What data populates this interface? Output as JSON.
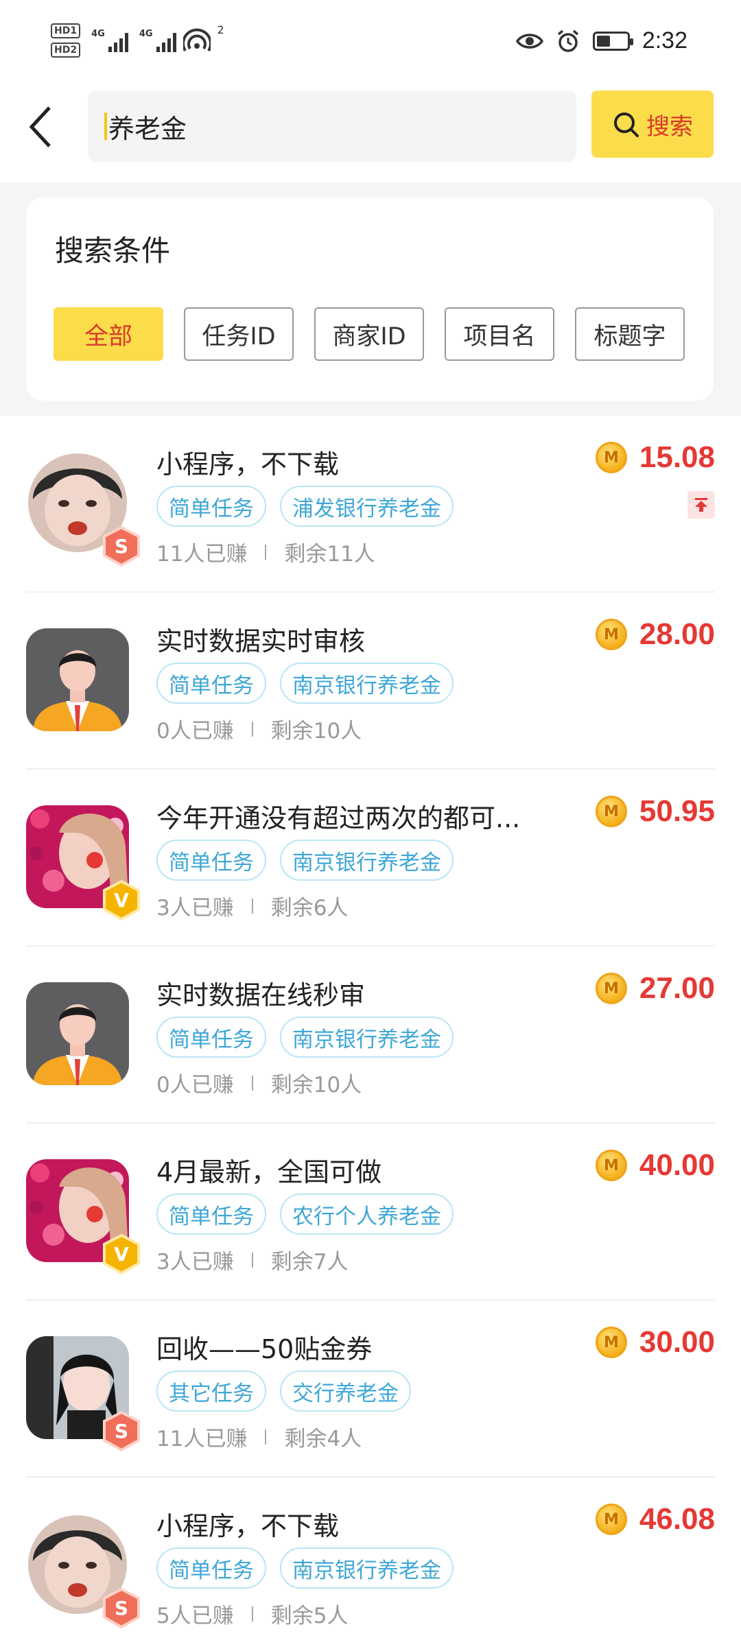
{
  "status_bar": {
    "time": "2:32",
    "hd1": "HD1",
    "hd2": "HD2",
    "net1": "4G",
    "net2": "4G",
    "wifi_sup": "2",
    "battery_level": 0.45
  },
  "header": {
    "search_value": "养老金",
    "search_button": "搜索"
  },
  "conditions": {
    "title": "搜索条件",
    "chips": [
      {
        "label": "全部",
        "active": true
      },
      {
        "label": "任务ID",
        "active": false
      },
      {
        "label": "商家ID",
        "active": false
      },
      {
        "label": "项目名",
        "active": false
      },
      {
        "label": "标题字",
        "active": false
      }
    ]
  },
  "colors": {
    "accent_yellow": "#fbdc4b",
    "price_red": "#e53935",
    "tag_blue": "#3fa7d6"
  },
  "tasks": [
    {
      "title": "小程序，不下载",
      "tag1": "简单任务",
      "tag2": "浦发银行养老金",
      "earned": "11人已赚",
      "remaining": "剩余11人",
      "price": "15.08",
      "avatar": "girl-pout",
      "badge": "S",
      "pinned": true
    },
    {
      "title": "实时数据实时审核",
      "tag1": "简单任务",
      "tag2": "南京银行养老金",
      "earned": "0人已赚",
      "remaining": "剩余10人",
      "price": "28.00",
      "avatar": "man-default",
      "badge": "",
      "pinned": false
    },
    {
      "title": "今年开通没有超过两次的都可...",
      "tag1": "简单任务",
      "tag2": "南京银行养老金",
      "earned": "3人已赚",
      "remaining": "剩余6人",
      "price": "50.95",
      "avatar": "girl-flowers",
      "badge": "V",
      "pinned": false
    },
    {
      "title": "实时数据在线秒审",
      "tag1": "简单任务",
      "tag2": "南京银行养老金",
      "earned": "0人已赚",
      "remaining": "剩余10人",
      "price": "27.00",
      "avatar": "man-default",
      "badge": "",
      "pinned": false
    },
    {
      "title": "4月最新，全国可做",
      "tag1": "简单任务",
      "tag2": "农行个人养老金",
      "earned": "3人已赚",
      "remaining": "剩余7人",
      "price": "40.00",
      "avatar": "girl-flowers",
      "badge": "V",
      "pinned": false
    },
    {
      "title": "回收——50贴金券",
      "tag1": "其它任务",
      "tag2": "交行养老金",
      "earned": "11人已赚",
      "remaining": "剩余4人",
      "price": "30.00",
      "avatar": "girl-car",
      "badge": "S",
      "pinned": false
    },
    {
      "title": "小程序，不下载",
      "tag1": "简单任务",
      "tag2": "南京银行养老金",
      "earned": "5人已赚",
      "remaining": "剩余5人",
      "price": "46.08",
      "avatar": "girl-pout",
      "badge": "S",
      "pinned": false
    }
  ]
}
